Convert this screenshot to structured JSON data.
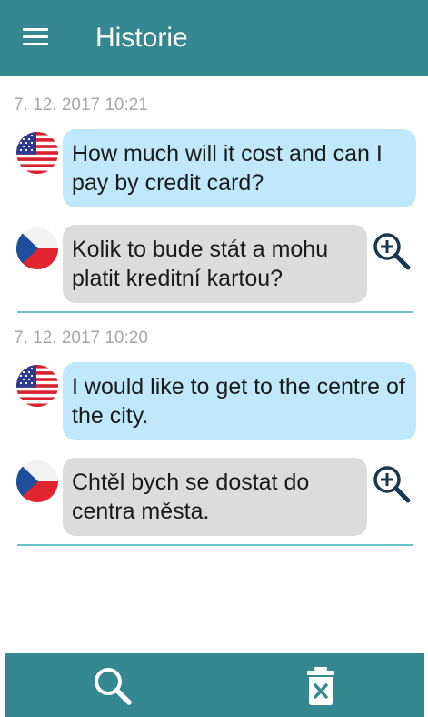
{
  "app": {
    "title": "Historie"
  },
  "history": [
    {
      "timestamp": "7. 12. 2017 10:21",
      "source": {
        "lang": "en",
        "flag_icon": "us-flag-icon",
        "text": "How much will it cost and can I pay by credit card?"
      },
      "target": {
        "lang": "cs",
        "flag_icon": "czech-flag-icon",
        "text": "Kolik to bude stát a mohu platit kreditní kartou?"
      }
    },
    {
      "timestamp": "7. 12. 2017 10:20",
      "source": {
        "lang": "en",
        "flag_icon": "us-flag-icon",
        "text": "I would like to get to the centre of the city."
      },
      "target": {
        "lang": "cs",
        "flag_icon": "czech-flag-icon",
        "text": "Chtěl bych se dostat do centra města."
      }
    }
  ],
  "toolbar": {
    "left_icon": "search-icon",
    "right_icon": "trash-icon"
  },
  "colors": {
    "primary": "#358790",
    "source_bubble": "#bfe9fa",
    "target_bubble": "#dcdcdc",
    "divider": "#6cc3cc",
    "timestamp": "#a7a7a7",
    "zoom_icon": "#17384f"
  }
}
